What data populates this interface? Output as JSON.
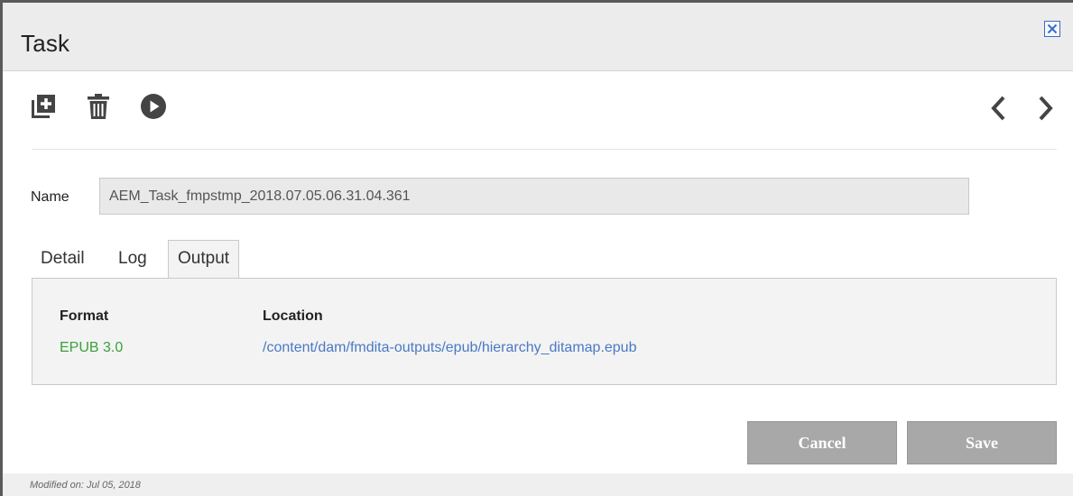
{
  "dialog": {
    "title": "Task",
    "close_icon": "close-icon"
  },
  "toolbar": {
    "icons": [
      "duplicate-icon",
      "trash-icon",
      "play-icon",
      "chevron-left-icon",
      "chevron-right-icon"
    ]
  },
  "name": {
    "label": "Name",
    "value": "AEM_Task_fmpstmp_2018.07.05.06.31.04.361"
  },
  "tabs": [
    {
      "label": "Detail",
      "active": false
    },
    {
      "label": "Log",
      "active": false
    },
    {
      "label": "Output",
      "active": true
    }
  ],
  "output": {
    "columns": [
      "Format",
      "Location"
    ],
    "rows": [
      {
        "format": "EPUB 3.0",
        "location": "/content/dam/fmdita-outputs/epub/hierarchy_ditamap.epub"
      }
    ]
  },
  "buttons": {
    "cancel": "Cancel",
    "save": "Save"
  },
  "footer": {
    "modified": "Modified on: Jul 05, 2018"
  },
  "colors": {
    "format_green": "#3ca03c",
    "link_blue": "#4a79c4",
    "button_gray": "#a8a8a8",
    "close_blue": "#3a6cc5"
  }
}
